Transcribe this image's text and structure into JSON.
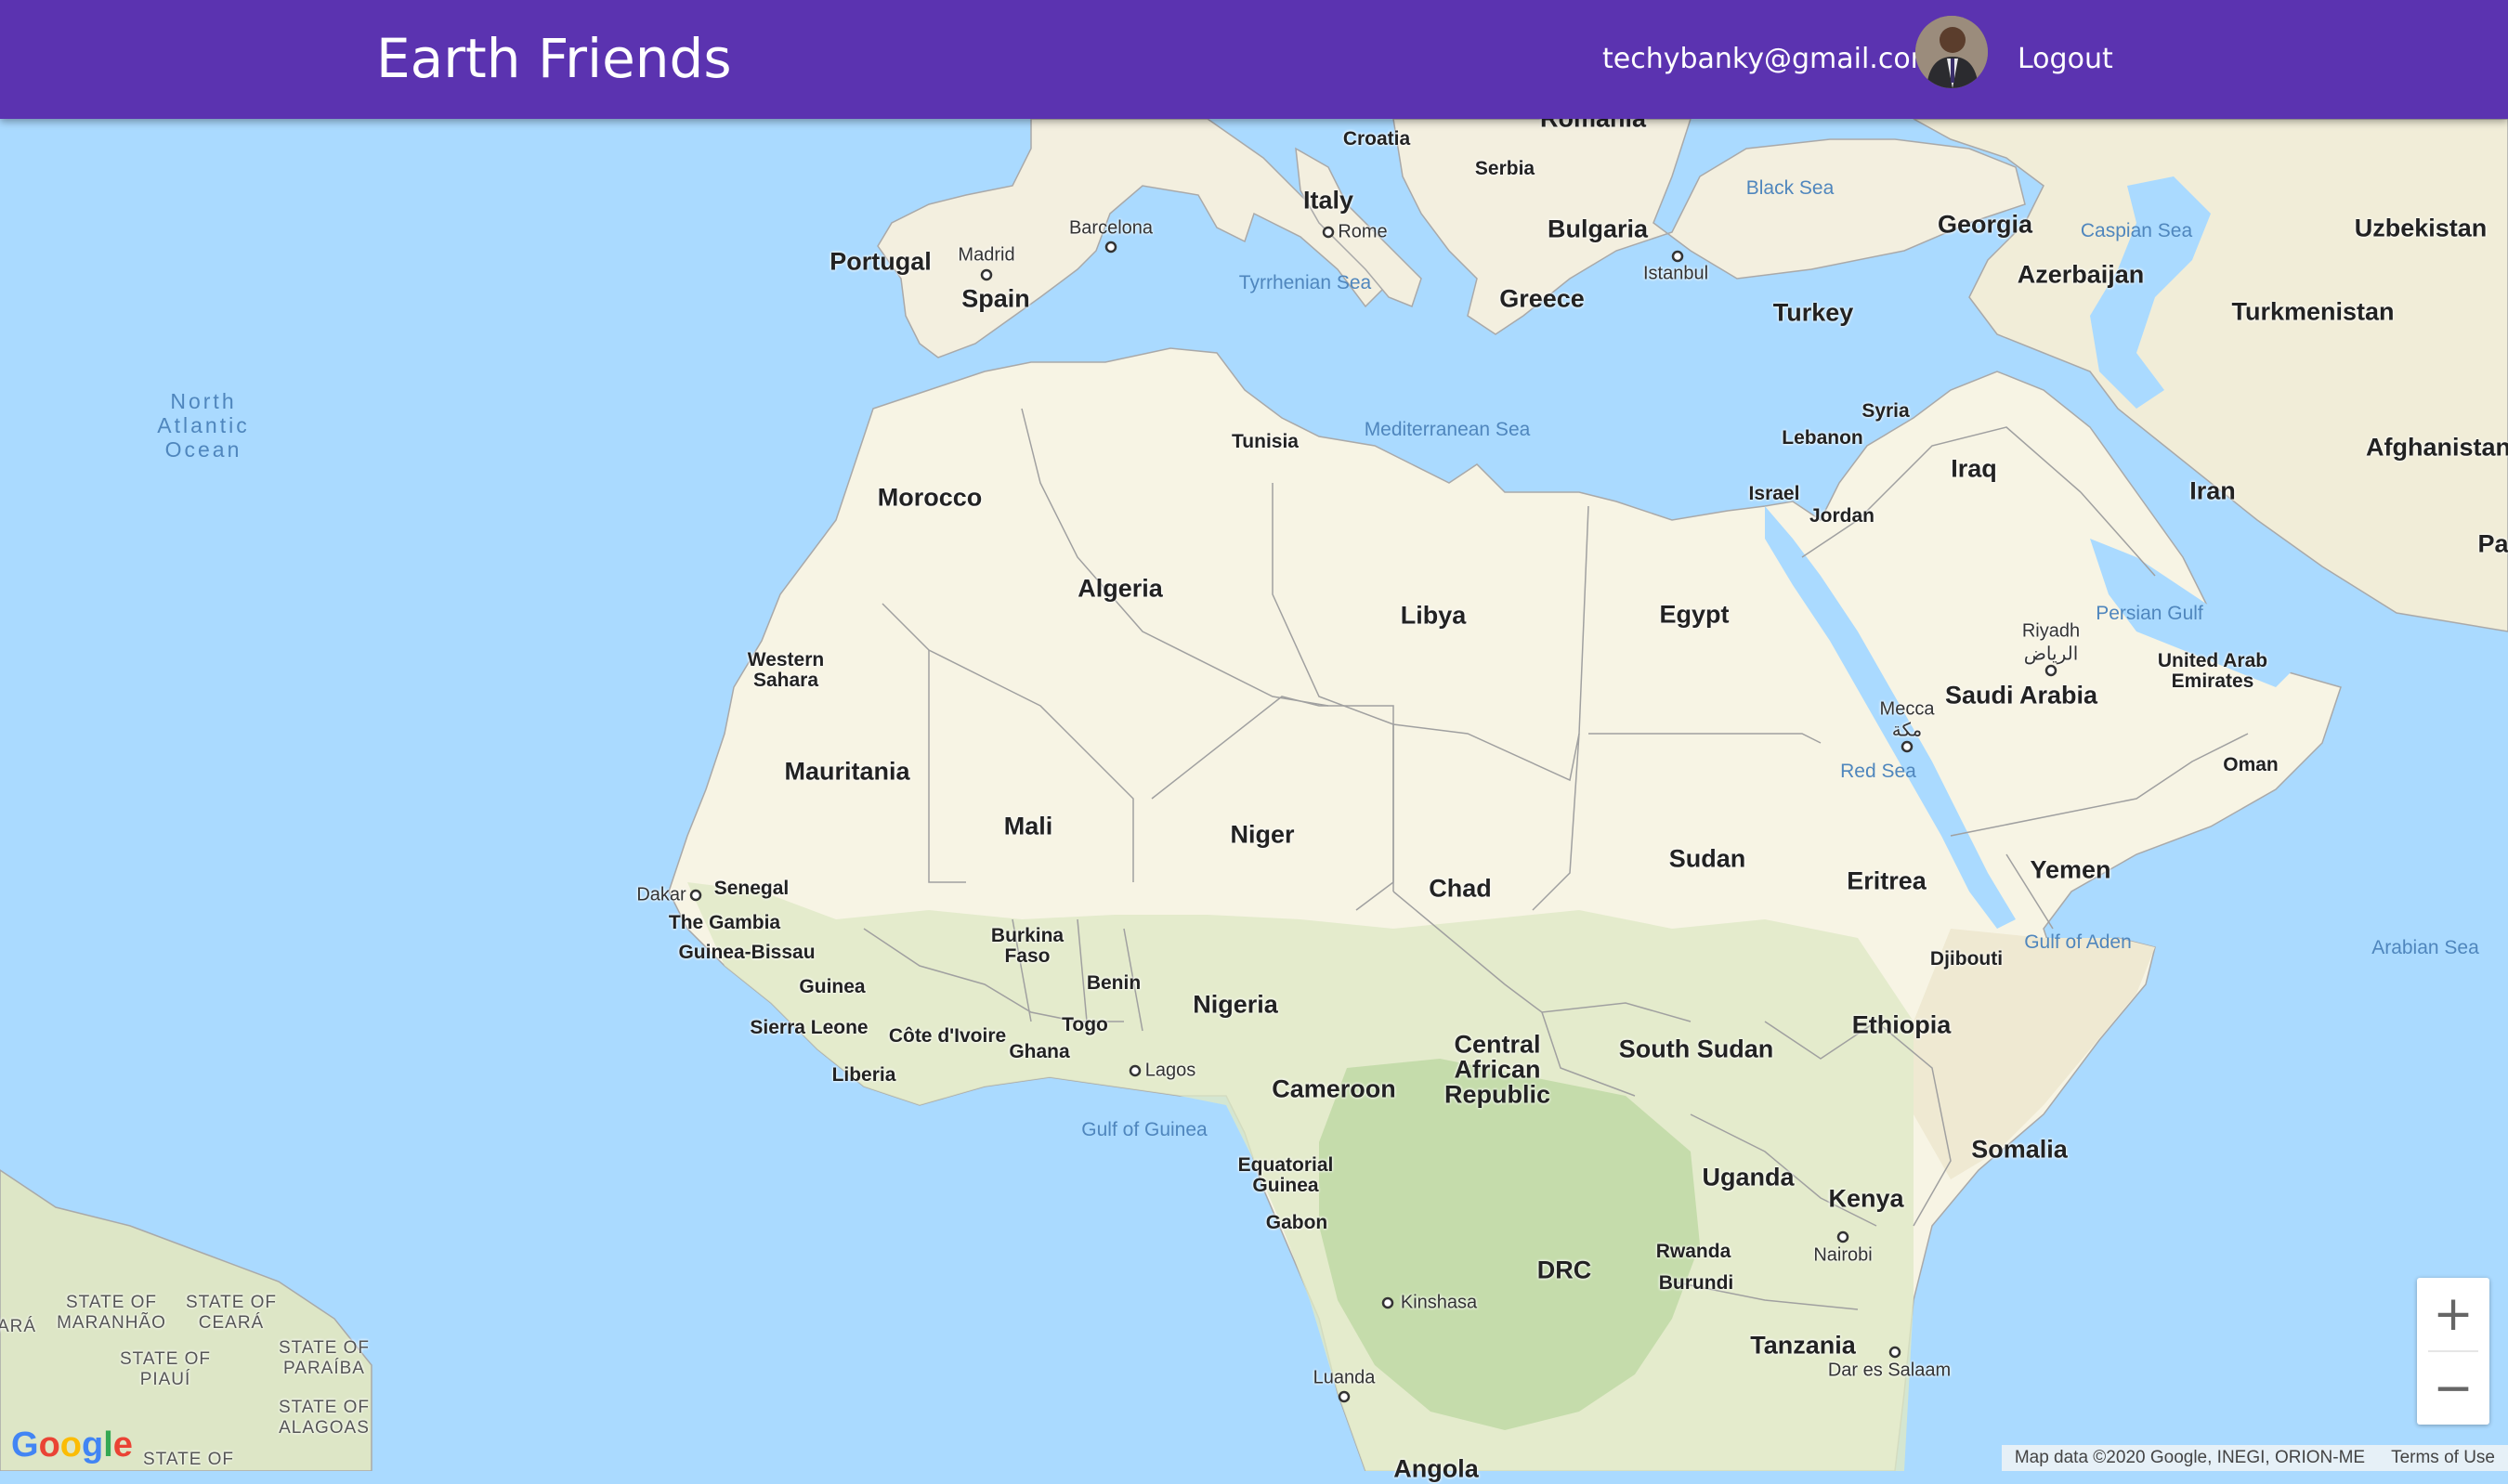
{
  "header": {
    "brand": "Earth Friends",
    "user_email": "techybanky@gmail.com",
    "logout_label": "Logout",
    "background_color": "#5b33b0"
  },
  "map": {
    "marker_country": "Nigeria",
    "labels": {
      "countries": [
        "Romania",
        "Croatia",
        "Serbia",
        "Italy",
        "Bulgaria",
        "Portugal",
        "Spain",
        "Greece",
        "Turkey",
        "Georgia",
        "Azerbaijan",
        "Uzbekistan",
        "Turkmenistan",
        "Syria",
        "Lebanon",
        "Iraq",
        "Iran",
        "Afghanistan",
        "Pa",
        "Israel",
        "Jordan",
        "Tunisia",
        "Morocco",
        "Algeria",
        "Libya",
        "Egypt",
        "Western Sahara",
        "Saudi Arabia",
        "United Arab Emirates",
        "Oman",
        "Mauritania",
        "Mali",
        "Niger",
        "Chad",
        "Sudan",
        "Eritrea",
        "Yemen",
        "Senegal",
        "The Gambia",
        "Guinea-Bissau",
        "Guinea",
        "Sierra Leone",
        "Liberia",
        "Côte d'Ivoire",
        "Ghana",
        "Togo",
        "Benin",
        "Burkina Faso",
        "Nigeria",
        "Cameroon",
        "Central African Republic",
        "South Sudan",
        "Ethiopia",
        "Djibouti",
        "Somalia",
        "Equatorial Guinea",
        "Gabon",
        "Uganda",
        "Kenya",
        "DRC",
        "Rwanda",
        "Burundi",
        "Tanzania",
        "Angola"
      ],
      "cities": [
        "Madrid",
        "Barcelona",
        "Rome",
        "Istanbul",
        "Riyadh",
        "الرياض",
        "Mecca",
        "مكة",
        "Dakar",
        "Lagos",
        "Nairobi",
        "Kinshasa",
        "Dar es Salaam",
        "Luanda"
      ],
      "seas": [
        "Black Sea",
        "Caspian Sea",
        "Tyrrhenian Sea",
        "Mediterranean Sea",
        "Persian Gulf",
        "Red Sea",
        "Gulf of Aden",
        "Arabian Sea",
        "Gulf of Guinea"
      ],
      "oceans": [
        "North Atlantic Ocean"
      ],
      "states": [
        "STATE OF MARANHÃO",
        "STATE OF CEARÁ",
        "STATE OF PIAUÍ",
        "STATE OF PARAÍBA",
        "STATE OF ALAGOAS",
        "STATE OF"
      ],
      "partial": [
        "ARÁ"
      ]
    },
    "zoom_in_label": "+",
    "zoom_out_label": "−",
    "google_logo": "Google",
    "attribution": {
      "map_data": "Map data ©2020 Google, INEGI, ORION-ME",
      "terms": "Terms of Use"
    }
  }
}
